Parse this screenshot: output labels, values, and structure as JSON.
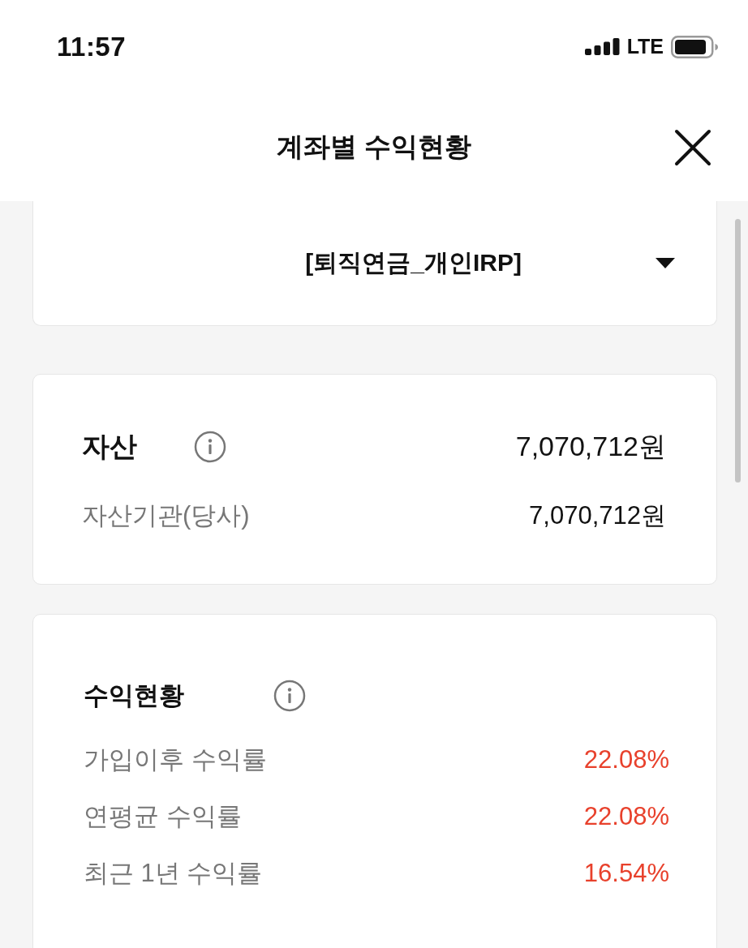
{
  "status_bar": {
    "time": "11:57",
    "network": "LTE"
  },
  "header": {
    "title": "계좌별 수익현황"
  },
  "account_selector": {
    "value": "[퇴직연금_개인IRP]"
  },
  "assets": {
    "title": "자산",
    "total": "7,070,712원",
    "rows": [
      {
        "label": "자산기관(당사)",
        "value": "7,070,712원"
      }
    ]
  },
  "returns": {
    "title": "수익현황",
    "rows": [
      {
        "label": "가입이후 수익률",
        "value": "22.08%"
      },
      {
        "label": "연평균 수익률",
        "value": "22.08%"
      },
      {
        "label": "최근 1년 수익률",
        "value": "16.54%"
      }
    ]
  }
}
